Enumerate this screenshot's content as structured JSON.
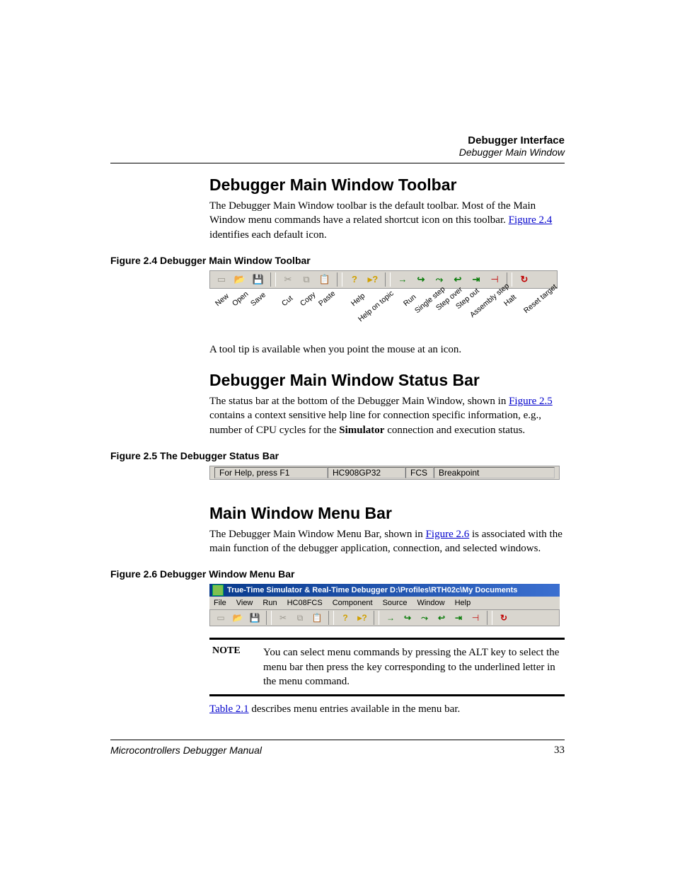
{
  "header": {
    "line1": "Debugger Interface",
    "line2": "Debugger Main Window"
  },
  "section1": {
    "title": "Debugger Main Window Toolbar",
    "para_a": "The Debugger Main Window toolbar is the default toolbar. Most of the Main Window menu commands have a related shortcut icon on this toolbar. ",
    "link": "Figure 2.4",
    "para_b": " identifies each default icon.",
    "fig_caption": "Figure 2.4  Debugger Main Window Toolbar",
    "labels": [
      "New",
      "Open",
      "Save",
      "Cut",
      "Copy",
      "Paste",
      "Help",
      "Help on topic",
      "Run",
      "Single step",
      "Step over",
      "Step out",
      "Assembly step",
      "Halt",
      "Reset target"
    ],
    "tooltip_line": "A tool tip is available when you point the mouse at an icon."
  },
  "section2": {
    "title": "Debugger Main Window Status Bar",
    "para_a": "The status bar at the bottom of the Debugger Main Window, shown in ",
    "link": "Figure 2.5",
    "para_b": " contains a context sensitive help line for connection specific information, e.g., number of CPU cycles for the ",
    "bold": "Simulator",
    "para_c": " connection and execution status.",
    "fig_caption": "Figure 2.5  The Debugger Status Bar",
    "status": {
      "help": "For Help, press F1",
      "chip": "HC908GP32",
      "mode": "FCS",
      "state": "Breakpoint"
    }
  },
  "section3": {
    "title": "Main Window Menu Bar",
    "para_a": "The Debugger Main Window Menu Bar, shown in ",
    "link": "Figure 2.6",
    "para_b": " is associated with the main function of the debugger application, connection, and selected windows.",
    "fig_caption": "Figure 2.6  Debugger Window Menu Bar",
    "titlebar": "True-Time Simulator & Real-Time Debugger   D:\\Profiles\\RTH02c\\My Documents",
    "menus": [
      "File",
      "View",
      "Run",
      "HC08FCS",
      "Component",
      "Source",
      "Window",
      "Help"
    ],
    "note_label": "NOTE",
    "note_text": "You can select menu commands by pressing the ALT key to select the menu bar then press the key corresponding to the underlined letter in the menu command.",
    "table_link": "Table 2.1",
    "table_after": " describes menu entries available in the menu bar."
  },
  "footer": {
    "book": "Microcontrollers Debugger Manual",
    "page": "33"
  }
}
